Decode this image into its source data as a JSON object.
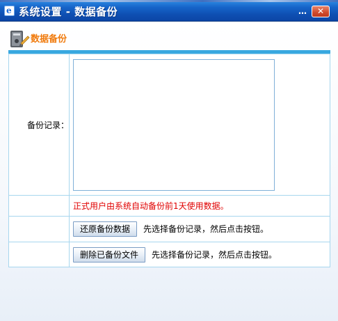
{
  "window": {
    "title": "系统设置 - 数据备份",
    "minimize_glyph": "…",
    "close_glyph": "✕"
  },
  "section": {
    "title": "数据备份"
  },
  "form": {
    "record_label": "备份记录：",
    "notice": "正式用户由系统自动备份前1天使用数据。",
    "restore_button": "还原备份数据",
    "restore_hint": "先选择备份记录，然后点击按钮。",
    "delete_button": "删除已备份文件",
    "delete_hint": "先选择备份记录，然后点击按钮。"
  },
  "colors": {
    "accent_title": "#f07a0c",
    "notice_red": "#e00000",
    "rule_blue": "#38a8e0",
    "border_blue": "#a7d6ee"
  }
}
